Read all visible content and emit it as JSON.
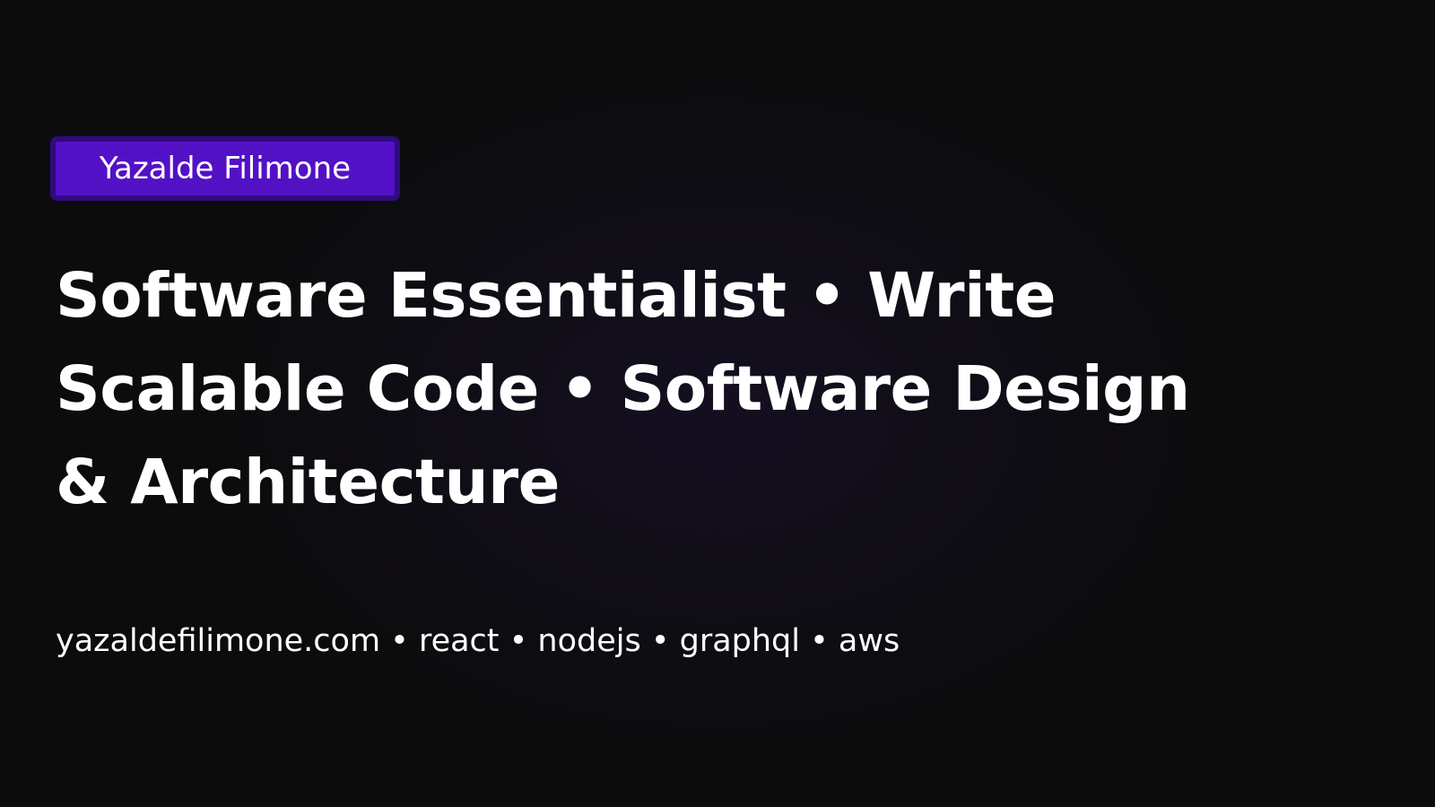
{
  "author_badge": "Yazalde Filimone",
  "headline": "Software Essentialist • Write Scalable Code • Software Design & Architecture",
  "footer": "yazaldefilimone.com • react • nodejs • graphql • aws",
  "colors": {
    "background": "#0c0c0d",
    "badge_fill": "#5311c6",
    "badge_border": "#2f0b7e",
    "grid_accent": "#6a2fd6",
    "text": "#ffffff"
  }
}
